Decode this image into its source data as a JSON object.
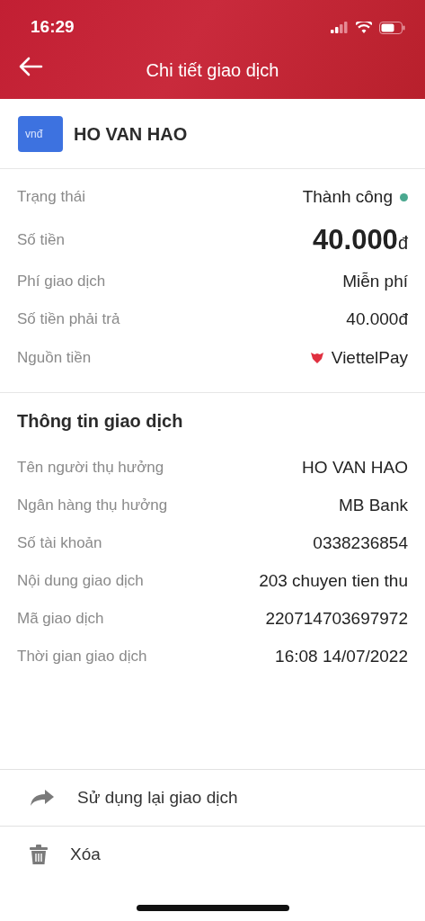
{
  "status_bar": {
    "time": "16:29"
  },
  "header": {
    "title": "Chi tiết giao dịch"
  },
  "payee": {
    "name": "HO VAN HAO",
    "wallet_label": "vnđ"
  },
  "summary": [
    {
      "kind": "status",
      "label": "Trạng thái",
      "value": "Thành công",
      "color": "#4aa88f"
    },
    {
      "kind": "amount",
      "label": "Số tiền",
      "value": "40.000",
      "unit": "đ"
    },
    {
      "kind": "plain",
      "label": "Phí giao dịch",
      "value": "Miễn phí"
    },
    {
      "kind": "plain",
      "label": "Số tiền phải trả",
      "value": "40.000đ"
    },
    {
      "kind": "source",
      "label": "Nguồn tiền",
      "value": "ViettelPay"
    }
  ],
  "details": {
    "title": "Thông tin giao dịch",
    "rows": [
      {
        "label": "Tên người thụ hưởng",
        "value": "HO VAN HAO"
      },
      {
        "label": "Ngân hàng thụ hưởng",
        "value": "MB Bank"
      },
      {
        "label": "Số tài khoản",
        "value": "0338236854"
      },
      {
        "label": "Nội dung giao dịch",
        "value": "203 chuyen tien thu"
      },
      {
        "label": "Mã giao dịch",
        "value": "220714703697972"
      },
      {
        "label": "Thời gian giao dịch",
        "value": "16:08 14/07/2022"
      }
    ]
  },
  "actions": [
    {
      "kind": "reuse",
      "label": "Sử dụng lại giao dịch"
    },
    {
      "kind": "delete",
      "label": "Xóa"
    }
  ]
}
